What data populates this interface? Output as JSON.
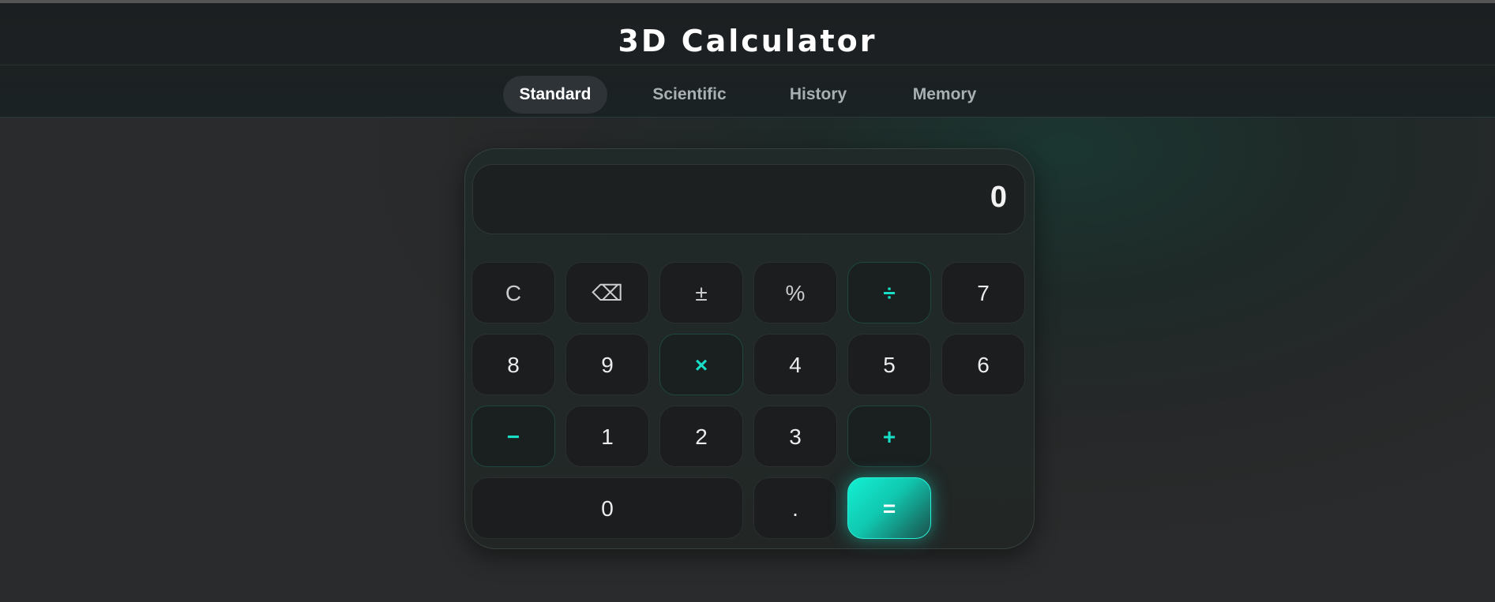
{
  "app": {
    "title": "3D Calculator"
  },
  "tabs": [
    {
      "label": "Standard",
      "active": true
    },
    {
      "label": "Scientific",
      "active": false
    },
    {
      "label": "History",
      "active": false
    },
    {
      "label": "Memory",
      "active": false
    }
  ],
  "display": {
    "value": "0"
  },
  "keys": {
    "clear": "C",
    "backspace": "⌫",
    "plus_minus": "±",
    "percent": "%",
    "divide": "÷",
    "seven": "7",
    "eight": "8",
    "nine": "9",
    "multiply": "×",
    "four": "4",
    "five": "5",
    "six": "6",
    "minus": "−",
    "one": "1",
    "two": "2",
    "three": "3",
    "plus": "+",
    "zero": "0",
    "decimal": ".",
    "equals": "="
  },
  "colors": {
    "accent": "#18e0c8",
    "background": "#262829",
    "key_background": "#1b1d1e"
  }
}
